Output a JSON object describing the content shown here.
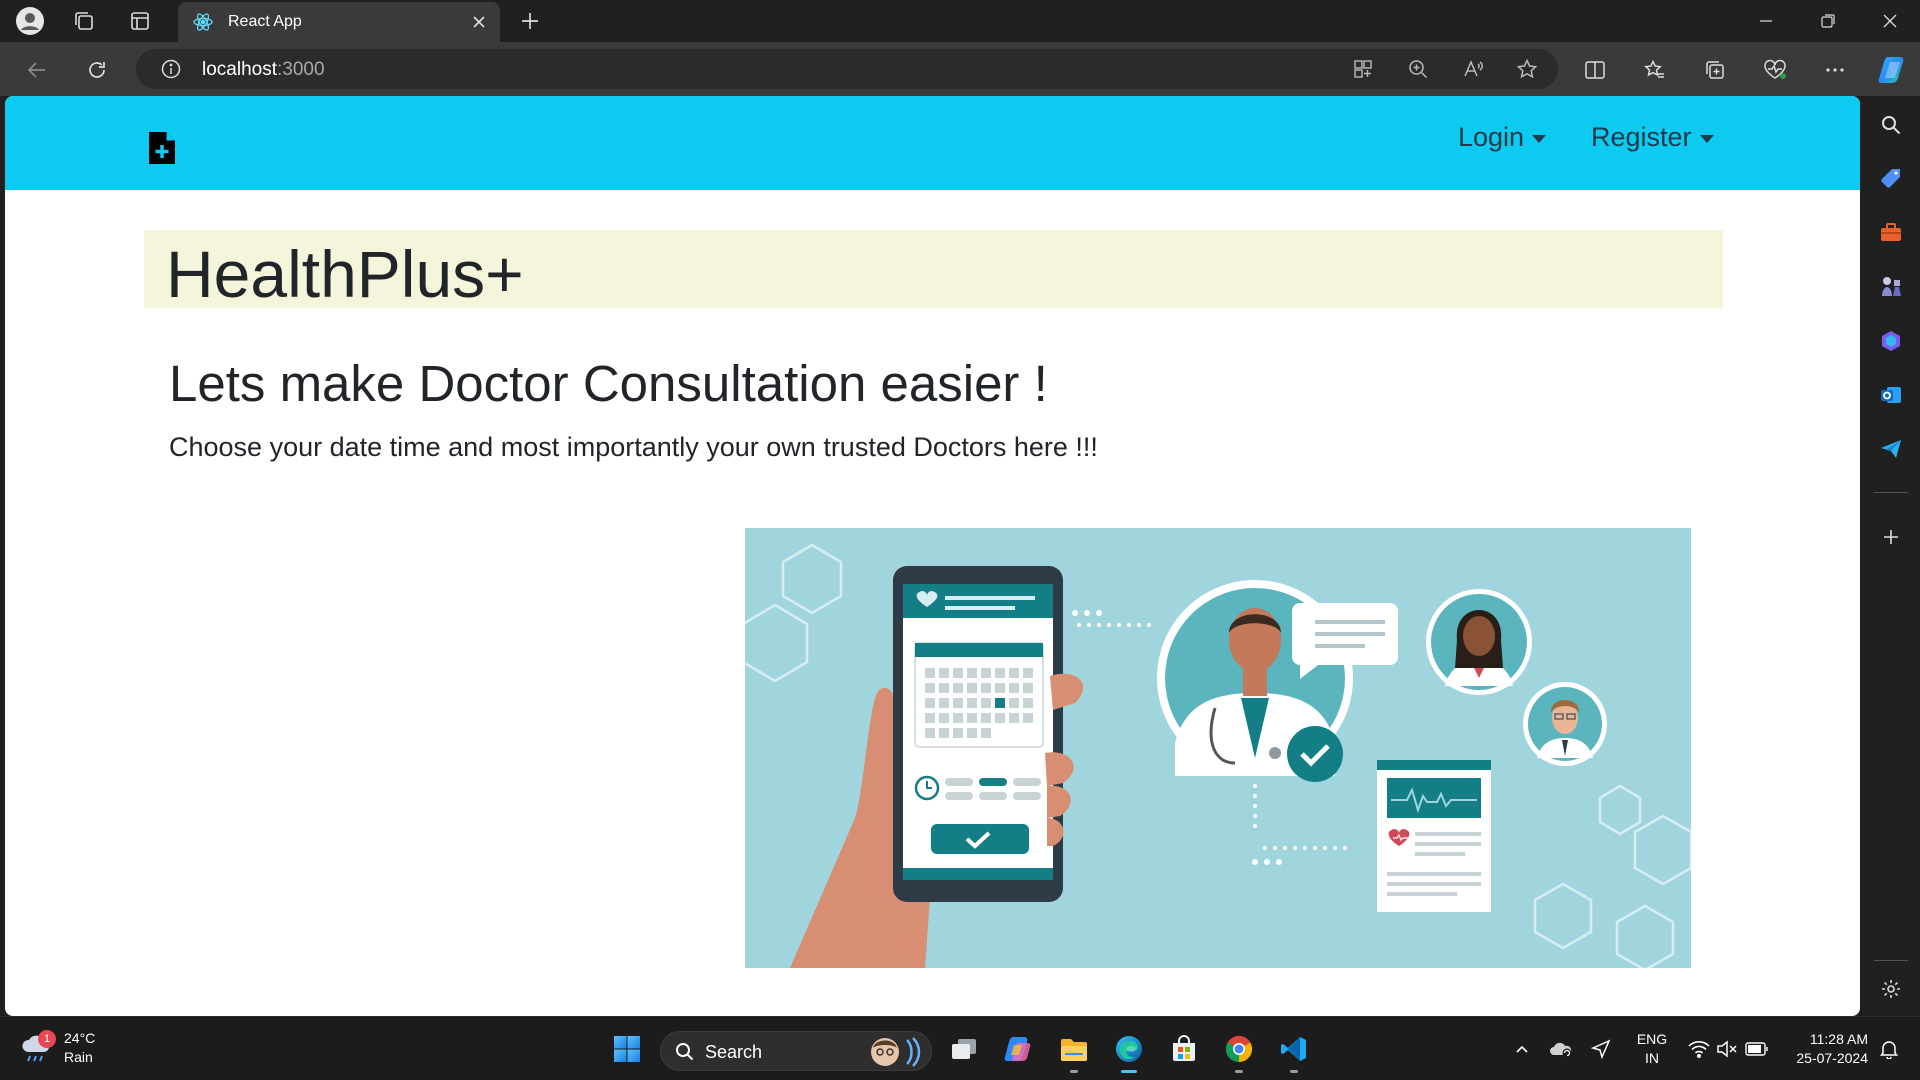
{
  "browser": {
    "tab_title": "React App",
    "url_host": "localhost",
    "url_port": ":3000"
  },
  "navbar": {
    "brand_icon": "file-plus-icon",
    "login_label": "Login",
    "register_label": "Register",
    "color": "#0dcaf0"
  },
  "page": {
    "brand_title": "HealthPlus+",
    "headline": "Lets make Doctor Consultation easier !",
    "subline": "Choose your date time and most importantly your own trusted Doctors here !!!",
    "jumbotron_bg": "#f5f5dc"
  },
  "taskbar": {
    "weather_badge": "1",
    "weather_temp": "24°C",
    "weather_desc": "Rain",
    "search_label": "Search",
    "lang_line1": "ENG",
    "lang_line2": "IN",
    "time": "11:28 AM",
    "date": "25-07-2024"
  }
}
